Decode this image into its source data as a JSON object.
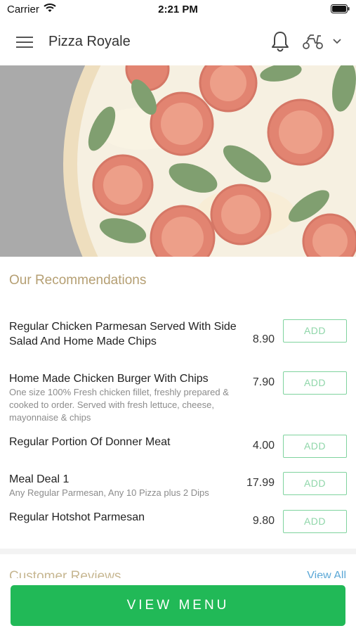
{
  "status_bar": {
    "carrier": "Carrier",
    "time": "2:21 PM"
  },
  "header": {
    "title": "Pizza Royale"
  },
  "recommendations": {
    "title": "Our Recommendations",
    "items": [
      {
        "name": "Regular Chicken Parmesan Served With Side Salad And Home Made Chips",
        "description": "",
        "price": "8.90",
        "add_label": "ADD"
      },
      {
        "name": "Home Made Chicken Burger With Chips",
        "description": "One size  100% Fresh chicken fillet, freshly prepared & cooked to order. Served with fresh lettuce, cheese, mayonnaise & chips",
        "price": "7.90",
        "add_label": "ADD"
      },
      {
        "name": "Regular Portion Of Donner Meat",
        "description": "",
        "price": "4.00",
        "add_label": "ADD"
      },
      {
        "name": "Meal Deal 1",
        "description": "Any Regular Parmesan, Any 10 Pizza plus 2 Dips",
        "price": "17.99",
        "add_label": "ADD"
      },
      {
        "name": "Regular Hotshot Parmesan",
        "description": "",
        "price": "9.80",
        "add_label": "ADD"
      }
    ]
  },
  "reviews": {
    "title": "Customer Reviews",
    "view_all": "View All"
  },
  "bottom": {
    "view_menu": "VIEW MENU"
  },
  "colors": {
    "accent_green": "#21b957",
    "add_border": "#7fd39e",
    "section_title": "#b59f73",
    "link_blue": "#5aa7d6"
  }
}
